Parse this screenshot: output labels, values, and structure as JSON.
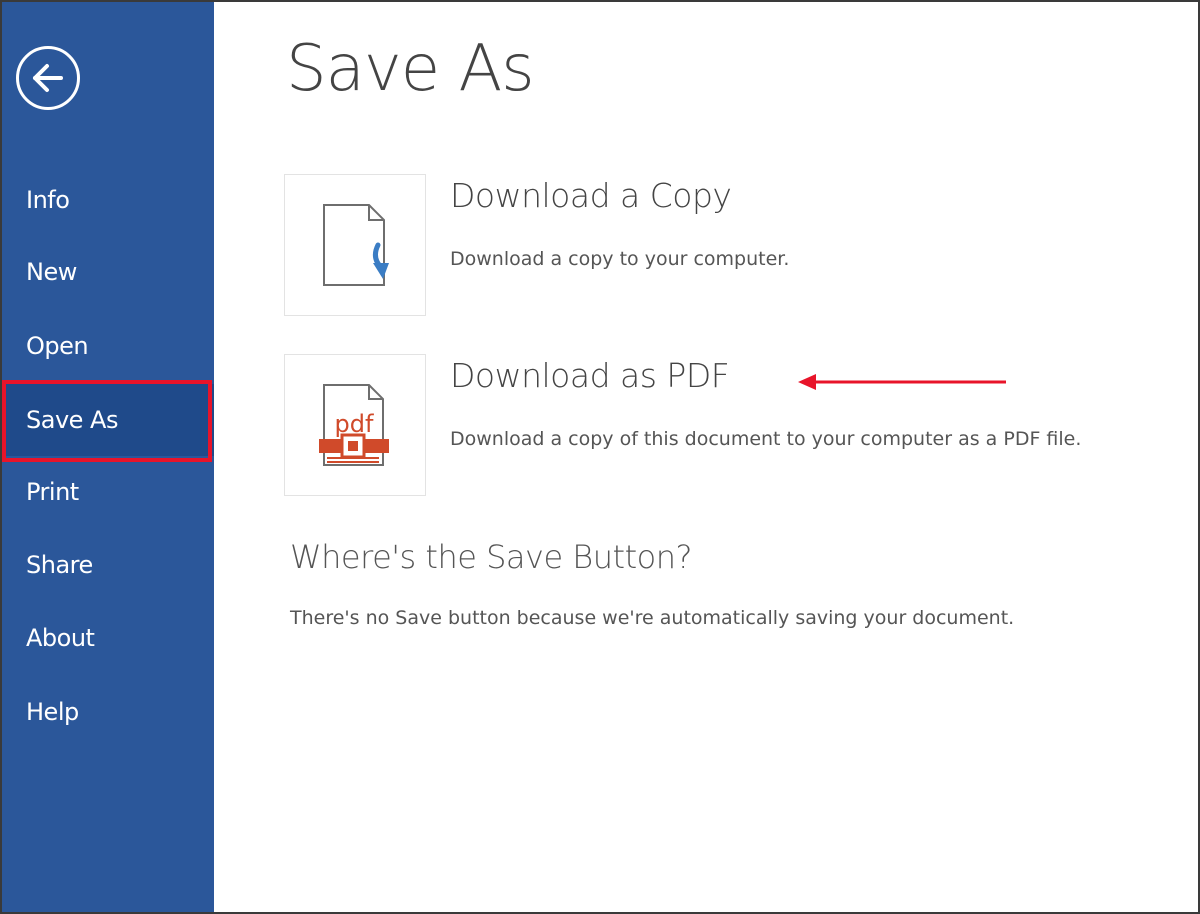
{
  "sidebar": {
    "back_icon": "arrow-left-circle-icon",
    "items": [
      {
        "label": "Info"
      },
      {
        "label": "New"
      },
      {
        "label": "Open"
      },
      {
        "label": "Save As",
        "active": true
      },
      {
        "label": "Print"
      },
      {
        "label": "Share"
      },
      {
        "label": "About"
      },
      {
        "label": "Help"
      }
    ]
  },
  "main": {
    "title": "Save As",
    "options": [
      {
        "title": "Download a Copy",
        "description": "Download a copy to your computer.",
        "icon": "document-download-icon"
      },
      {
        "title": "Download as PDF",
        "description": "Download a copy of this document to your computer as a PDF file.",
        "icon": "pdf-file-icon",
        "icon_text": "pdf"
      }
    ],
    "save_section": {
      "title": "Where's the Save Button?",
      "description": "There's no Save button because we're automatically saving your document."
    }
  },
  "colors": {
    "sidebar_bg": "#2b579a",
    "sidebar_active_bg": "#1f4a8a",
    "highlight_red": "#e8142a",
    "pdf_orange": "#d04a2a",
    "download_blue": "#3b7dc4"
  }
}
